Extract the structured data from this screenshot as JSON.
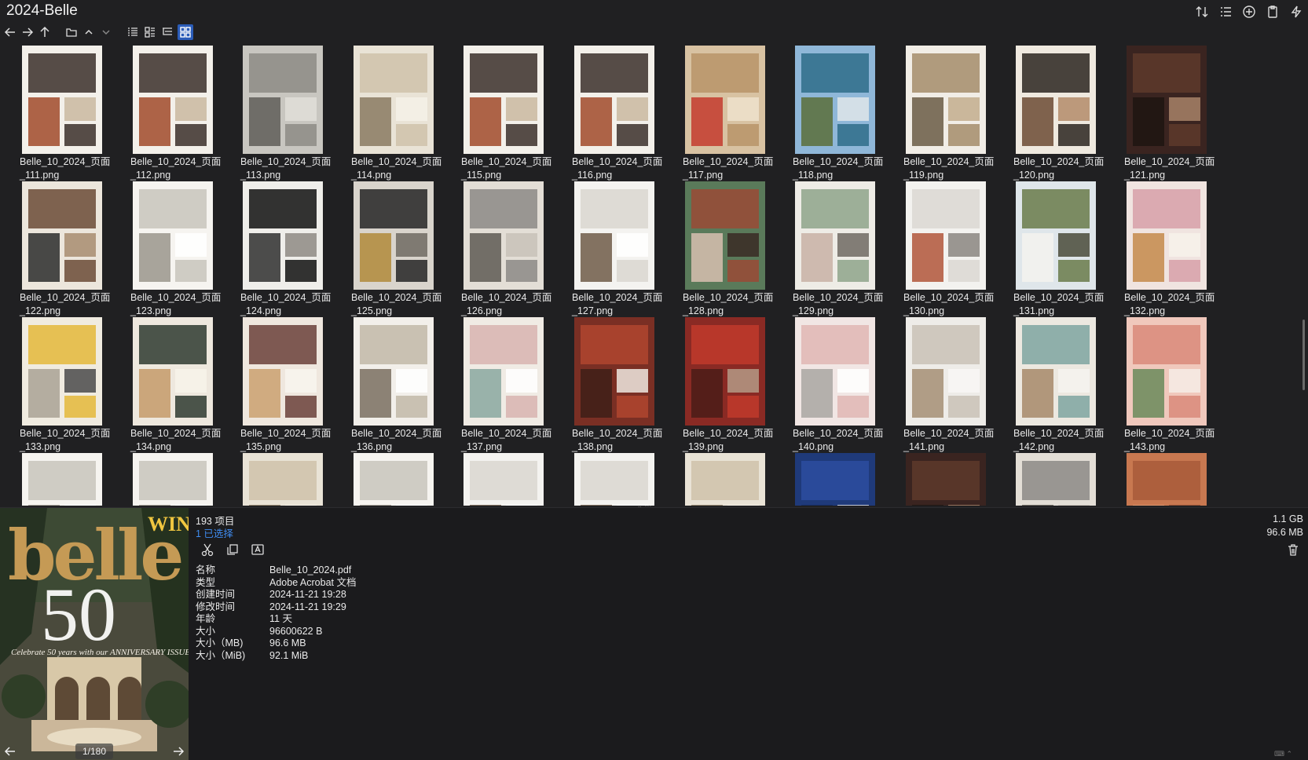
{
  "window": {
    "title": "2024-Belle"
  },
  "grid": {
    "items": [
      {
        "l1": "Belle_10_2024_页面",
        "l2": "_111.png",
        "scheme": "collage"
      },
      {
        "l1": "Belle_10_2024_页面",
        "l2": "_112.png",
        "scheme": "collage"
      },
      {
        "l1": "Belle_10_2024_页面",
        "l2": "_113.png",
        "scheme": "grey"
      },
      {
        "l1": "Belle_10_2024_页面",
        "l2": "_114.png",
        "scheme": "beige"
      },
      {
        "l1": "Belle_10_2024_页面",
        "l2": "_115.png",
        "scheme": "collage"
      },
      {
        "l1": "Belle_10_2024_页面",
        "l2": "_116.png",
        "scheme": "collage"
      },
      {
        "l1": "Belle_10_2024_页面",
        "l2": "_117.png",
        "scheme": "tan"
      },
      {
        "l1": "Belle_10_2024_页面",
        "l2": "_118.png",
        "scheme": "pool"
      },
      {
        "l1": "Belle_10_2024_页面",
        "l2": "_119.png",
        "scheme": "veranda"
      },
      {
        "l1": "Belle_10_2024_页面",
        "l2": "_120.png",
        "scheme": "dark-room"
      },
      {
        "l1": "Belle_10_2024_页面",
        "l2": "_121.png",
        "scheme": "dark-brown"
      },
      {
        "l1": "Belle_10_2024_页面",
        "l2": "_122.png",
        "scheme": "interior"
      },
      {
        "l1": "Belle_10_2024_页面",
        "l2": "_123.png",
        "scheme": "text"
      },
      {
        "l1": "Belle_10_2024_页面",
        "l2": "_124.png",
        "scheme": "black"
      },
      {
        "l1": "Belle_10_2024_页面",
        "l2": "_125.png",
        "scheme": "stair"
      },
      {
        "l1": "Belle_10_2024_页面",
        "l2": "_126.png",
        "scheme": "bedroom"
      },
      {
        "l1": "Belle_10_2024_页面",
        "l2": "_127.png",
        "scheme": "white-room"
      },
      {
        "l1": "Belle_10_2024_页面",
        "l2": "_128.png",
        "scheme": "green-red"
      },
      {
        "l1": "Belle_10_2024_页面",
        "l2": "_129.png",
        "scheme": "green-bed"
      },
      {
        "l1": "Belle_10_2024_页面",
        "l2": "_130.png",
        "scheme": "white-hall"
      },
      {
        "l1": "Belle_10_2024_页面",
        "l2": "_131.png",
        "scheme": "house"
      },
      {
        "l1": "Belle_10_2024_页面",
        "l2": "_132.png",
        "scheme": "pink-lounge"
      },
      {
        "l1": "Belle_10_2024_页面",
        "l2": "_133.png",
        "scheme": "yellow"
      },
      {
        "l1": "Belle_10_2024_页面",
        "l2": "_134.png",
        "scheme": "dining"
      },
      {
        "l1": "Belle_10_2024_页面",
        "l2": "_135.png",
        "scheme": "kitchen"
      },
      {
        "l1": "Belle_10_2024_页面",
        "l2": "_136.png",
        "scheme": "kitchen-white"
      },
      {
        "l1": "Belle_10_2024_页面",
        "l2": "_137.png",
        "scheme": "pastel"
      },
      {
        "l1": "Belle_10_2024_页面",
        "l2": "_138.png",
        "scheme": "red-brown"
      },
      {
        "l1": "Belle_10_2024_页面",
        "l2": "_139.png",
        "scheme": "red"
      },
      {
        "l1": "Belle_10_2024_页面",
        "l2": "_140.png",
        "scheme": "pink-bath"
      },
      {
        "l1": "Belle_10_2024_页面",
        "l2": "_141.png",
        "scheme": "white-arch"
      },
      {
        "l1": "Belle_10_2024_页面",
        "l2": "_142.png",
        "scheme": "bedroom2"
      },
      {
        "l1": "Belle_10_2024_页面",
        "l2": "_143.png",
        "scheme": "pink-floral"
      },
      {
        "l1": "",
        "l2": "",
        "scheme": "text"
      },
      {
        "l1": "",
        "l2": "",
        "scheme": "text"
      },
      {
        "l1": "",
        "l2": "",
        "scheme": "beige"
      },
      {
        "l1": "",
        "l2": "",
        "scheme": "text"
      },
      {
        "l1": "",
        "l2": "",
        "scheme": "white-room"
      },
      {
        "l1": "",
        "l2": "",
        "scheme": "white-room"
      },
      {
        "l1": "",
        "l2": "",
        "scheme": "beige"
      },
      {
        "l1": "",
        "l2": "",
        "scheme": "blue"
      },
      {
        "l1": "",
        "l2": "",
        "scheme": "dark-brown"
      },
      {
        "l1": "",
        "l2": "",
        "scheme": "bedroom"
      },
      {
        "l1": "",
        "l2": "",
        "scheme": "terracotta"
      }
    ]
  },
  "preview": {
    "cover_title": "belle",
    "cover_number": "50",
    "cover_badge": "WIN",
    "cover_tagline": "Celebrate 50 years with our ANNIVERSARY ISSUE",
    "page_indicator": "1/180"
  },
  "status": {
    "item_count": "193 项目",
    "selected_count": "1 已选择",
    "total_size": "1.1 GB",
    "selected_size": "96.6 MB"
  },
  "properties": [
    {
      "key": "名称",
      "value": "Belle_10_2024.pdf"
    },
    {
      "key": "类型",
      "value": "Adobe Acrobat 文档"
    },
    {
      "key": "创建时间",
      "value": "2024-11-21  19:28"
    },
    {
      "key": "修改时间",
      "value": "2024-11-21  19:29"
    },
    {
      "key": "年龄",
      "value": "11 天"
    },
    {
      "key": "大小",
      "value": "96600622 B"
    },
    {
      "key": "大小（MB)",
      "value": "96.6 MB"
    },
    {
      "key": "大小（MiB)",
      "value": "92.1 MiB"
    }
  ],
  "colors": {
    "accent": "#2b5cb8",
    "link": "#3f8cf0",
    "background": "#202022"
  }
}
